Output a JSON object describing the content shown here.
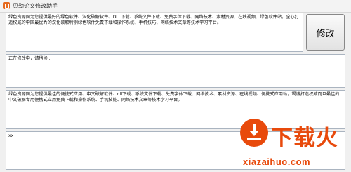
{
  "window": {
    "title": "贝勒论文修改助手",
    "app_icon": "document-edit-icon"
  },
  "source_text": "绿色资源网为您提供最好的绿色软件、汉化破解软件、DLL下载、系统文件下载、免费字体下载、网络技术、素材资源、在线视频、绿色软件站。全心打造权威的中国最优秀的汉化破解特别绿色软件免费下载和操作系统、手机技巧、网络技术文章等技术学习平台。",
  "modify_button": {
    "label": "修改"
  },
  "status_text": "正在修改中，请稍候...",
  "output_text": "绿色资源网为您提供最佳的便携式应用、中文破解软件、dll下载、系统文件下载、免费字体下载、网络技术、素材资源、在线视频、便携式应用站，竭诚打造权威而且最佳的中文破解专用便携式应用免费下载和操作系统、手机技能、网络技术文章等技术学习平台。",
  "input_text": "xx",
  "watermark": {
    "brand": "下载火",
    "domain": "xiazaihuo.com",
    "color": "#e84a0c",
    "icon": "download-arrow-icon"
  }
}
